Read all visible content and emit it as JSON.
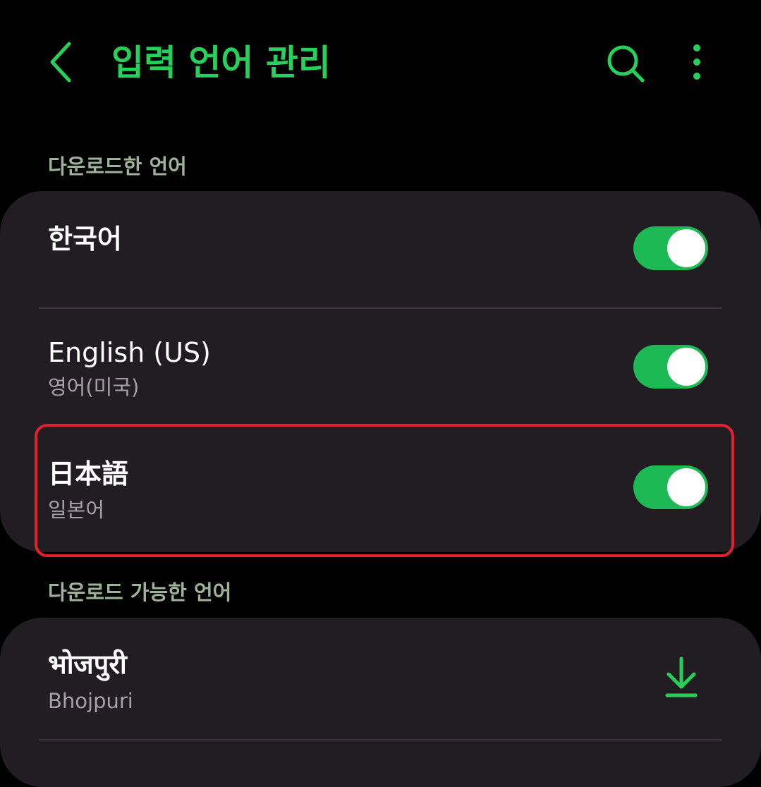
{
  "colors": {
    "accent": "#27d05a",
    "background": "#000000",
    "card": "#221c23",
    "section_header": "#9fb39a",
    "subtitle": "#a7a0a8",
    "toggle_on": "#1db954",
    "highlight": "#e1212b"
  },
  "header": {
    "title": "입력 언어 관리",
    "back_icon": "chevron-left-icon",
    "search_icon": "search-icon",
    "more_icon": "more-vertical-icon"
  },
  "downloaded": {
    "header": "다운로드한 언어",
    "items": [
      {
        "title": "한국어",
        "subtitle": "",
        "enabled": true
      },
      {
        "title": "English (US)",
        "subtitle": "영어(미국)",
        "enabled": true
      },
      {
        "title": "日本語",
        "subtitle": "일본어",
        "enabled": true
      }
    ]
  },
  "available": {
    "header": "다운로드 가능한 언어",
    "items": [
      {
        "title": "भोजपुरी",
        "subtitle": "Bhojpuri",
        "action_icon": "download-icon"
      }
    ]
  }
}
